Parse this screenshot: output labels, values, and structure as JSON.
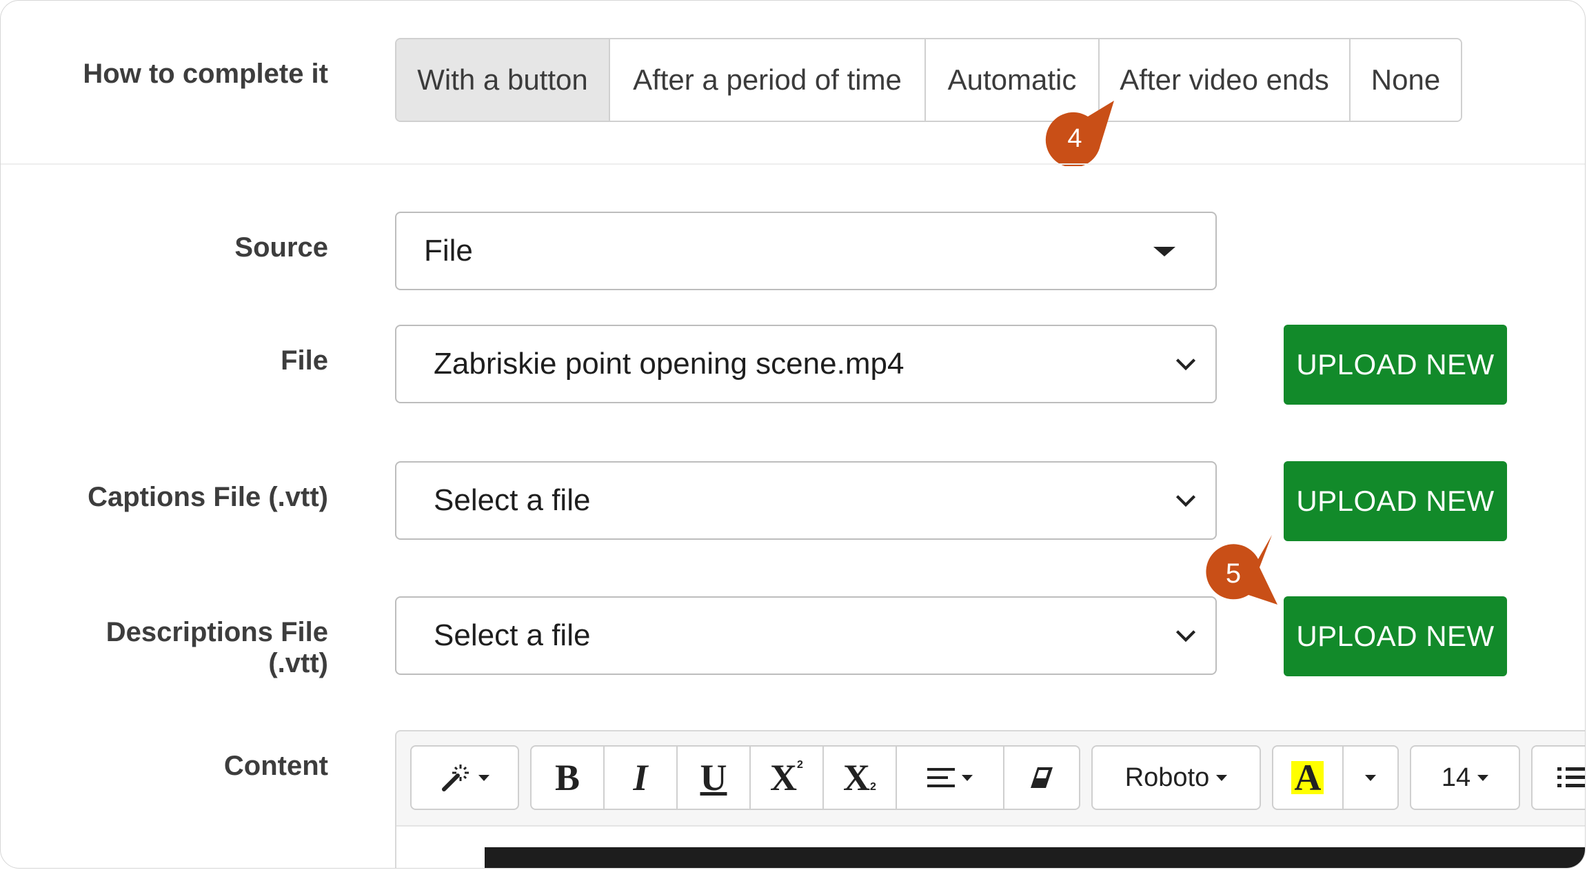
{
  "completion": {
    "label": "How to complete it",
    "options": [
      "With a button",
      "After a period of time",
      "Automatic",
      "After video ends",
      "None"
    ],
    "selected": "With a button"
  },
  "callouts": [
    {
      "number": "4",
      "color": "#c94f17"
    },
    {
      "number": "5",
      "color": "#c94f17"
    }
  ],
  "source": {
    "label": "Source",
    "value": "File"
  },
  "file": {
    "label": "File",
    "value": "Zabriskie point opening scene.mp4",
    "upload_label": "UPLOAD NEW"
  },
  "captions": {
    "label": "Captions File (.vtt)",
    "value": "Select a file",
    "upload_label": "UPLOAD NEW"
  },
  "descriptions": {
    "label": "Descriptions File (.vtt)",
    "value": "Select a file",
    "upload_label": "UPLOAD NEW"
  },
  "content": {
    "label": "Content",
    "toolbar": {
      "bold": "B",
      "italic": "I",
      "underline": "U",
      "superscript": "X",
      "subscript": "X",
      "font": "Roboto",
      "highlight": "A",
      "font_size": "14"
    }
  },
  "colors": {
    "upload_green": "#128a2a",
    "callout_orange": "#c94f17",
    "highlight_yellow": "#ffff00"
  }
}
